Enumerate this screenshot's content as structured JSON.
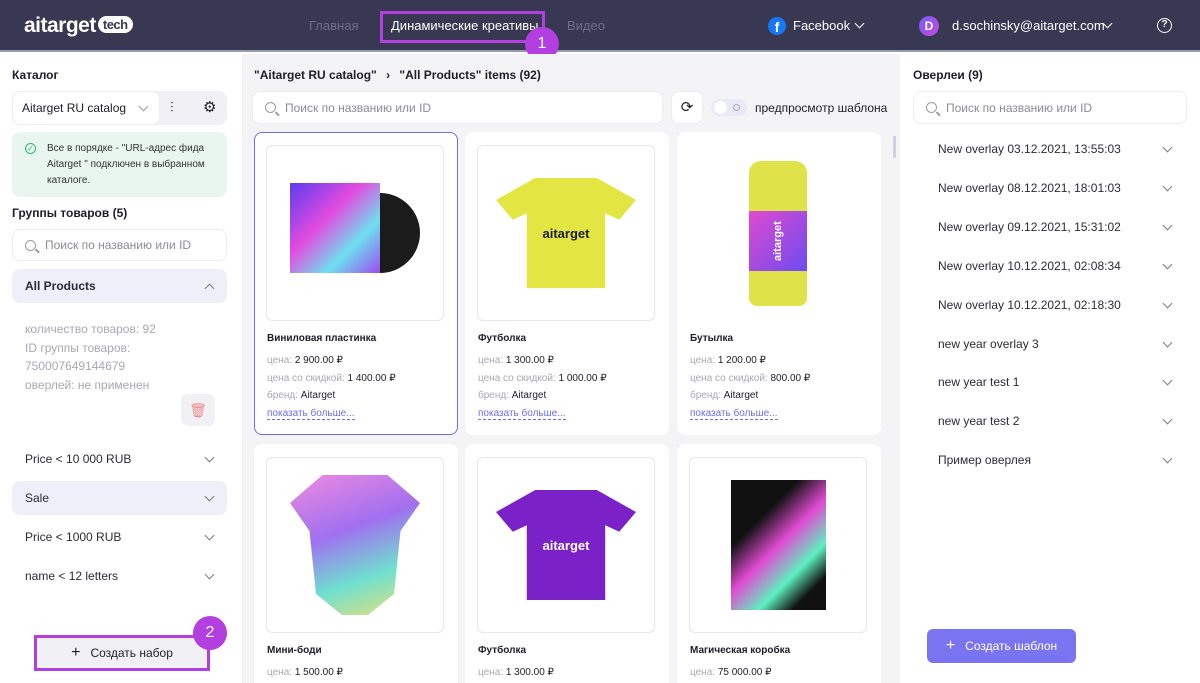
{
  "header": {
    "logo": "aitarget",
    "logo_tag": "tech",
    "nav": [
      "Главная",
      "Динамические креативы",
      "Видео"
    ],
    "platform": "Facebook",
    "avatar_letter": "D",
    "user": "d.sochinsky@aitarget.com",
    "annotations": [
      "1",
      "2"
    ]
  },
  "left": {
    "catalog_title": "Каталог",
    "catalog": "Aitarget RU catalog",
    "status": "Все в порядке - \"URL-адрес фида Aitarget \" подключен в выбранном каталоге.",
    "groups_title": "Группы товаров (5)",
    "search_placeholder": "Поиск по названию или ID",
    "groups": [
      "All Products",
      "Price < 10 000 RUB",
      "Sale",
      "Price < 1000 RUB",
      "name < 12 letters"
    ],
    "meta": [
      "количество товаров: 92",
      "ID группы товаров:",
      "750007649144679",
      "оверлей: не применен"
    ],
    "create": "Создать набор"
  },
  "mid": {
    "breadcrumb": [
      "\"Aitarget RU catalog\"",
      "\"All Products\" items (92)"
    ],
    "search_placeholder": "Поиск по названию или ID",
    "preview": "предпросмотр шаблона",
    "labels": {
      "price": "цена: ",
      "sale": "цена со скидкой: ",
      "brand": "бренд: ",
      "more": "показать больше..."
    },
    "products": [
      {
        "name": "Виниловая пластинка",
        "price": "2 900.00 ₽",
        "sale": "1 400.00 ₽",
        "brand": "Aitarget"
      },
      {
        "name": "Футболка",
        "price": "1 300.00 ₽",
        "sale": "1 000.00 ₽",
        "brand": "Aitarget",
        "img_text": "aitarget"
      },
      {
        "name": "Бутылка",
        "price": "1 200.00 ₽",
        "sale": "800.00 ₽",
        "brand": "Aitarget",
        "img_text": "aitarget"
      },
      {
        "name": "Мини-боди",
        "price": "1 500.00 ₽"
      },
      {
        "name": "Футболка",
        "price": "1 300.00 ₽",
        "img_text": "aitarget"
      },
      {
        "name": "Магическая коробка",
        "price": "75 000.00 ₽"
      }
    ]
  },
  "right": {
    "title": "Оверлеи (9)",
    "search_placeholder": "Поиск по названию или ID",
    "overlays": [
      "New overlay 03.12.2021, 13:55:03",
      "New overlay 08.12.2021, 18:01:03",
      "New overlay 09.12.2021, 15:31:02",
      "New overlay 10.12.2021, 02:08:34",
      "New overlay 10.12.2021, 02:18:30",
      "new year overlay 3",
      "new year test 1",
      "new year test 2",
      "Пример оверлея"
    ],
    "create": "Создать шаблон"
  }
}
